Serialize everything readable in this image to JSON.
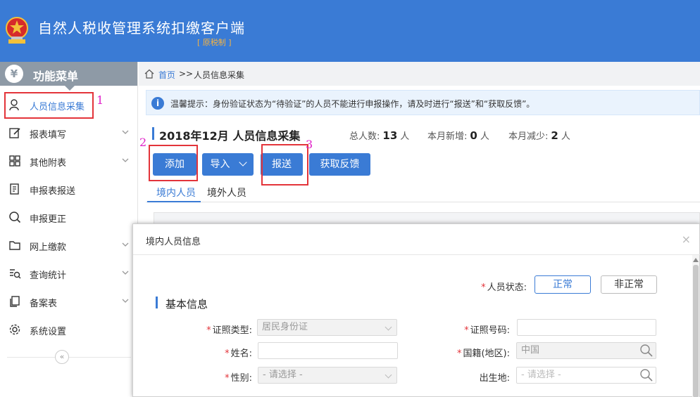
{
  "header": {
    "title": "自然人税收管理系统扣缴客户端",
    "subtitle": "[ 原税制 ]",
    "brand_color": "#3a7bd5"
  },
  "sidebar": {
    "heading": "功能菜单",
    "heading_icon": "¥",
    "items": [
      {
        "label": "人员信息采集",
        "icon": "user-icon",
        "active": true
      },
      {
        "label": "报表填写",
        "icon": "edit-icon",
        "expandable": true
      },
      {
        "label": "其他附表",
        "icon": "grid-icon",
        "expandable": true
      },
      {
        "label": "申报表报送",
        "icon": "doc-icon"
      },
      {
        "label": "申报更正",
        "icon": "search-icon"
      },
      {
        "label": "网上缴款",
        "icon": "folder-icon",
        "expandable": true
      },
      {
        "label": "查询统计",
        "icon": "query-icon",
        "expandable": true
      },
      {
        "label": "备案表",
        "icon": "files-icon",
        "expandable": true
      },
      {
        "label": "系统设置",
        "icon": "gear-icon"
      }
    ],
    "collapse_glyph": "«"
  },
  "breadcrumb": {
    "home": "首页",
    "separator": ">>",
    "current": "人员信息采集"
  },
  "notice": {
    "icon": "i",
    "text": "温馨提示：身份验证状态为“待验证”的人员不能进行申报操作，请及时进行“报送”和“获取反馈”。"
  },
  "page": {
    "title": "2018年12月  人员信息采集",
    "stats": [
      {
        "label": "总人数:",
        "value": "13",
        "unit": "人"
      },
      {
        "label": "本月新增:",
        "value": "0",
        "unit": "人"
      },
      {
        "label": "本月减少:",
        "value": "2",
        "unit": "人"
      }
    ]
  },
  "toolbar": {
    "add": "添加",
    "import": "导入",
    "submit": "报送",
    "feedback": "获取反馈"
  },
  "annotations": [
    "1",
    "2",
    "3"
  ],
  "tabs": [
    {
      "label": "境内人员",
      "active": true
    },
    {
      "label": "境外人员",
      "active": false
    }
  ],
  "modal": {
    "title": "境内人员信息",
    "close": "×",
    "section_title": "基本信息",
    "status": {
      "label": "人员状态:",
      "options": [
        "正常",
        "非正常"
      ],
      "selected": "正常"
    },
    "fields": {
      "id_type": {
        "label": "证照类型:",
        "value": "居民身份证"
      },
      "id_number": {
        "label": "证照号码:",
        "value": ""
      },
      "name": {
        "label": "姓名:",
        "value": ""
      },
      "nationality": {
        "label": "国籍(地区):",
        "value": "中国"
      },
      "gender": {
        "label": "性别:",
        "value": "- 请选择 -"
      },
      "birthplace": {
        "label": "出生地:",
        "placeholder": "- 请选择 -"
      }
    }
  }
}
